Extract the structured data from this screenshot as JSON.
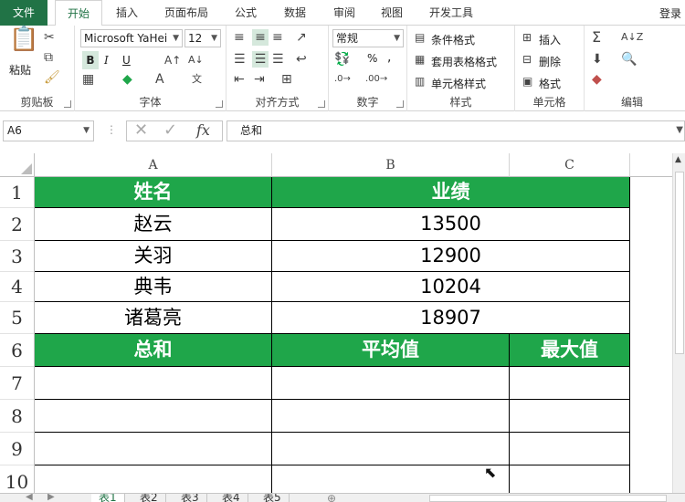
{
  "ribbon_tabs": [
    "文件",
    "开始",
    "插入",
    "页面布局",
    "公式",
    "数据",
    "审阅",
    "视图",
    "开发工具"
  ],
  "signin": "登录",
  "clipboard": {
    "paste": "粘贴",
    "label": "剪贴板"
  },
  "font": {
    "name": "Microsoft YaHei",
    "size": "12",
    "bold": "B",
    "italic": "I",
    "underline": "U",
    "label": "字体"
  },
  "alignment": {
    "label": "对齐方式"
  },
  "number": {
    "format": "常规",
    "percent": "%",
    "comma": ",",
    "label": "数字"
  },
  "styles": {
    "conditional": "条件格式",
    "table": "套用表格格式",
    "cell": "单元格样式",
    "label": "样式"
  },
  "cells": {
    "insert": "插入",
    "delete": "删除",
    "format": "格式",
    "label": "单元格"
  },
  "editing": {
    "label": "编辑"
  },
  "formula_bar": {
    "name_box": "A6",
    "fx": "fx",
    "formula": "总和"
  },
  "columns": [
    "A",
    "B",
    "C"
  ],
  "rows": [
    "1",
    "2",
    "3",
    "4",
    "5",
    "6",
    "7",
    "8",
    "9",
    "10"
  ],
  "table": {
    "header": {
      "name": "姓名",
      "score": "业绩"
    },
    "records": [
      {
        "name": "赵云",
        "score": "13500"
      },
      {
        "name": "关羽",
        "score": "12900"
      },
      {
        "name": "典韦",
        "score": "10204"
      },
      {
        "name": "诸葛亮",
        "score": "18907"
      }
    ],
    "summary": {
      "sum": "总和",
      "avg": "平均值",
      "max": "最大值"
    }
  },
  "sheets": [
    "表1",
    "表2",
    "表3",
    "表4",
    "表5"
  ],
  "colors": {
    "accent": "#217346",
    "header_fill": "#1fa64a"
  }
}
